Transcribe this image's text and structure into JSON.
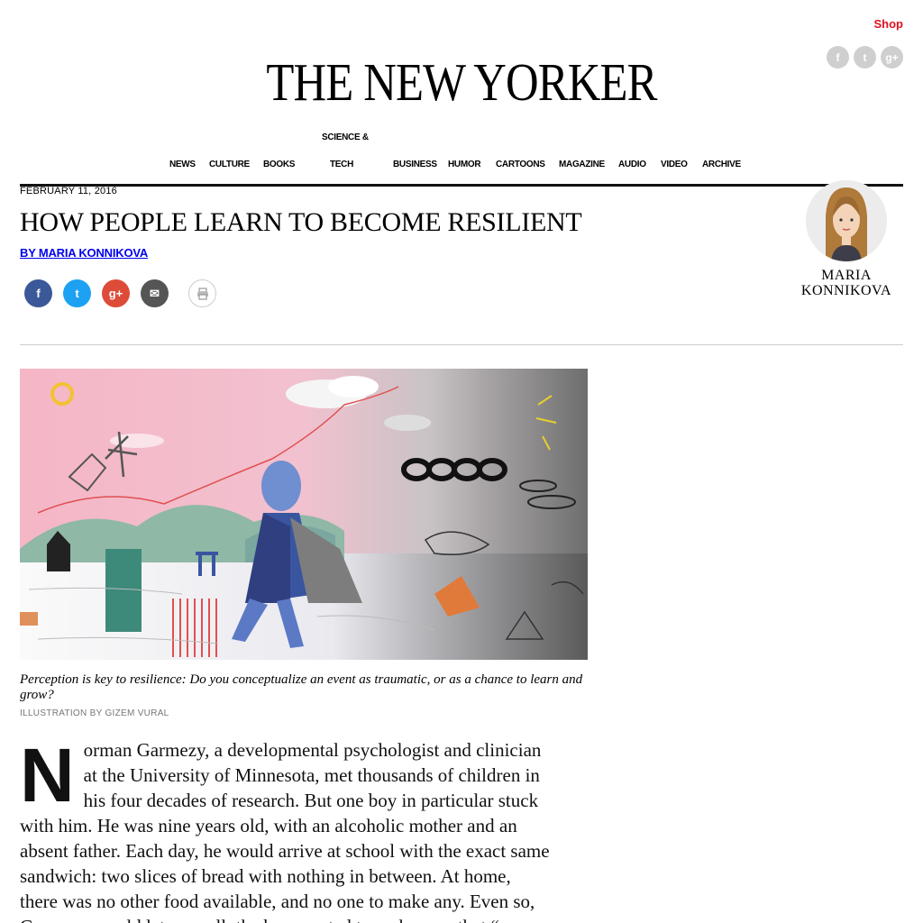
{
  "header": {
    "shop_label": "Shop",
    "social": [
      {
        "icon": "facebook-icon",
        "glyph": "f"
      },
      {
        "icon": "twitter-icon",
        "glyph": "t"
      },
      {
        "icon": "google-plus-icon",
        "glyph": "g+"
      }
    ],
    "masthead": "THE NEW YORKER"
  },
  "nav": {
    "items": [
      "NEWS",
      "CULTURE",
      "BOOKS",
      "SCIENCE &",
      "TECH",
      "BUSINESS",
      "HUMOR",
      "CARTOONS",
      "MAGAZINE",
      "AUDIO",
      "VIDEO",
      "ARCHIVE"
    ]
  },
  "article": {
    "date": "FEBRUARY 11, 2016",
    "headline": "HOW PEOPLE LEARN TO BECOME RESILIENT",
    "byline": "BY MARIA KONNIKOVA",
    "share": [
      {
        "icon": "facebook-share-icon",
        "glyph": "f",
        "color": "#3b5998"
      },
      {
        "icon": "twitter-share-icon",
        "glyph": "t",
        "color": "#1da1f2"
      },
      {
        "icon": "google-plus-share-icon",
        "glyph": "g+",
        "color": "#dd4b39"
      },
      {
        "icon": "email-share-icon",
        "glyph": "✉",
        "color": "#555555"
      }
    ],
    "caption": "Perception is key to resilience: Do you conceptualize an event as traumatic, or as a chance to learn and grow?",
    "credit": "ILLUSTRATION BY GIZEM VURAL",
    "dropcap": "N",
    "body": "orman Garmezy, a developmental psychologist and clinician at the University of Minnesota, met thousands of children in his four decades of research. But one boy in particular stuck with him. He was nine years old, with an alcoholic mother and an absent father. Each day, he would arrive at school with the exact same sandwich: two slices of bread with nothing in between. At home, there was no other food available, and no one to make any. Even so, Garmezy would later recall, the boy wanted to make sure that “no one would feel"
  },
  "author_card": {
    "name_line1": "MARIA",
    "name_line2": "KONNIKOVA"
  },
  "colors": {
    "shop": "#dd1122",
    "rule": "#111111",
    "illustration_pink": "#f4b8c8",
    "illustration_gray": "#8a8a8a"
  }
}
